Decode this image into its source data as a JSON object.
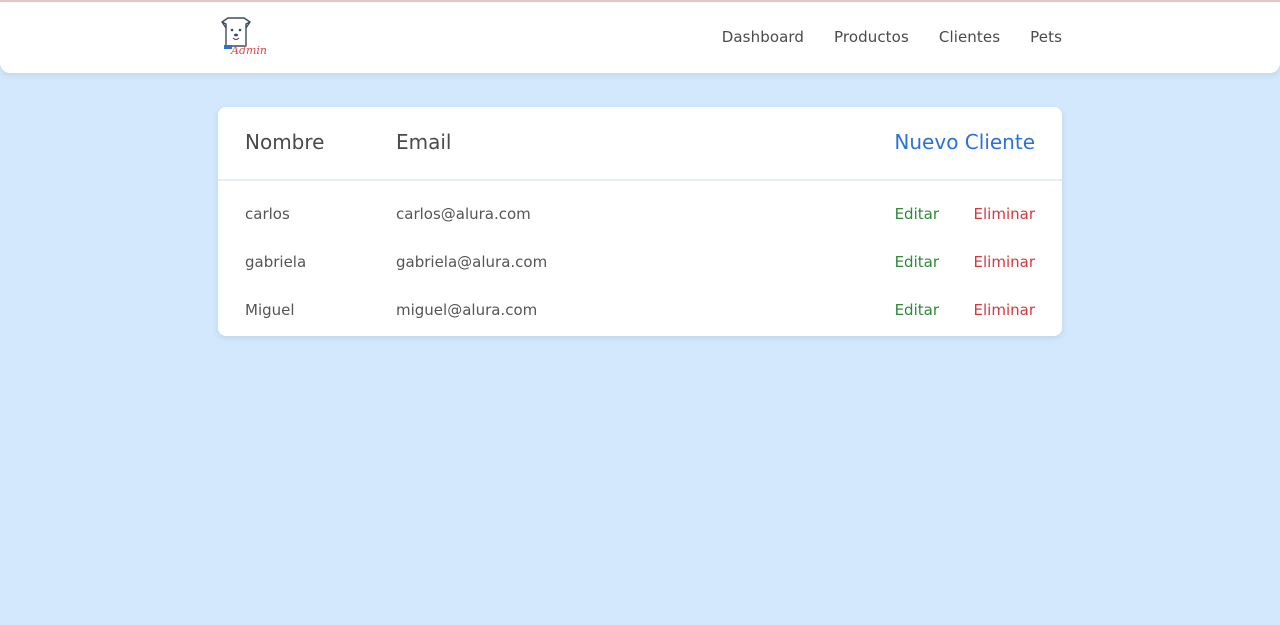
{
  "header": {
    "logo_alt": "Admin",
    "nav": [
      "Dashboard",
      "Productos",
      "Clientes",
      "Pets"
    ]
  },
  "table": {
    "columns": [
      "Nombre",
      "Email"
    ],
    "new_label": "Nuevo Cliente",
    "rows": [
      {
        "name": "carlos",
        "email": "carlos@alura.com",
        "edit": "Editar",
        "delete": "Eliminar"
      },
      {
        "name": "gabriela",
        "email": "gabriela@alura.com",
        "edit": "Editar",
        "delete": "Eliminar"
      },
      {
        "name": "Miguel",
        "email": "miguel@alura.com",
        "edit": "Editar",
        "delete": "Eliminar"
      }
    ]
  },
  "colors": {
    "background": "#d3e8fc",
    "link_blue": "#2a72d6",
    "edit_green": "#2f8a34",
    "delete_red": "#d5373b"
  }
}
